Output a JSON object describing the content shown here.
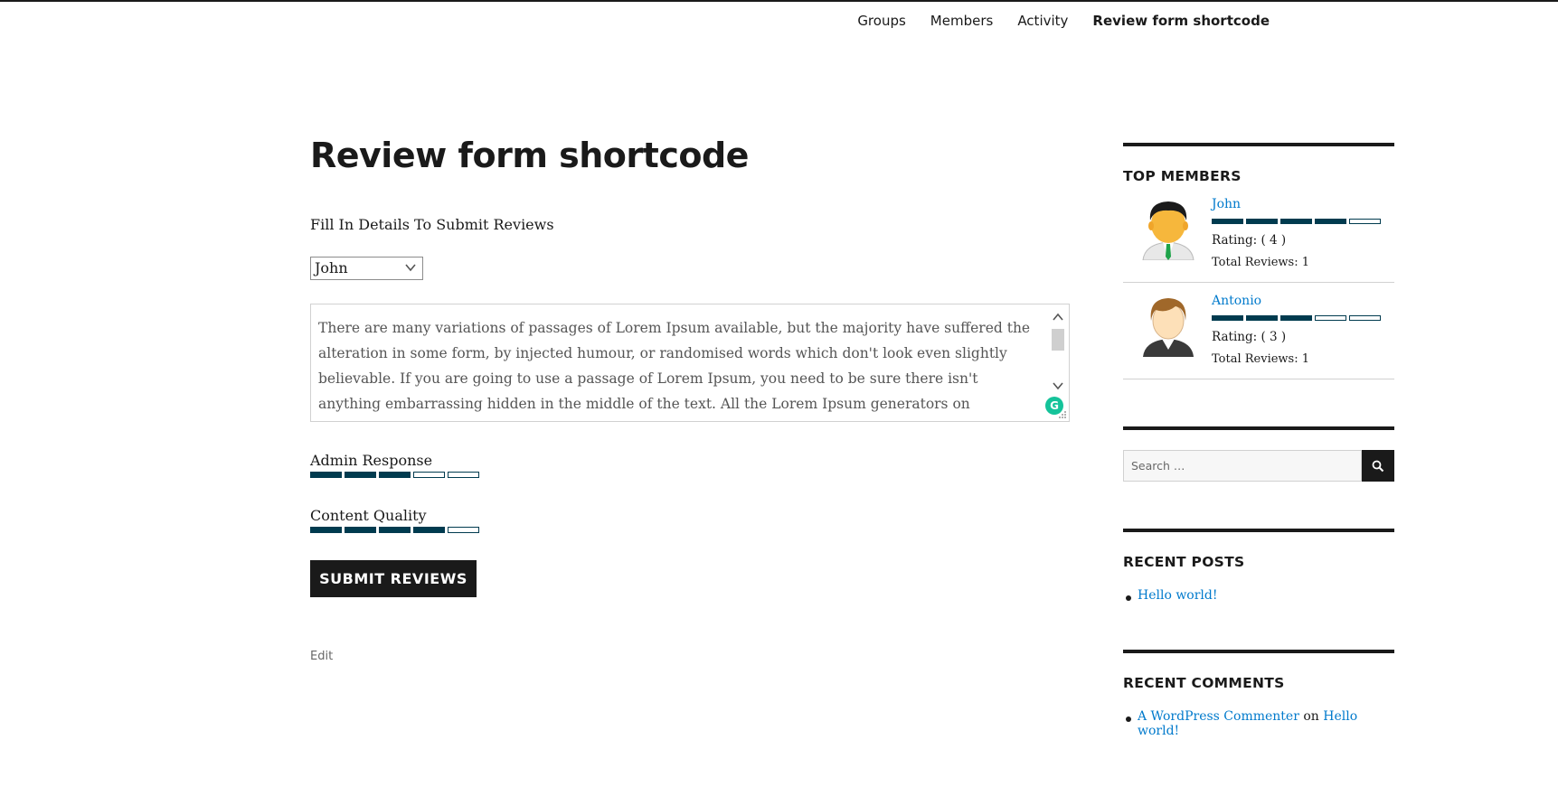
{
  "nav": {
    "items": [
      "Groups",
      "Members",
      "Activity",
      "Review form shortcode"
    ],
    "current": "Review form shortcode"
  },
  "main": {
    "title": "Review form shortcode",
    "intro": "Fill In Details To Submit Reviews",
    "member_select": {
      "selected": "John"
    },
    "review_text": "There are many variations of passages of Lorem Ipsum available, but the majority have suffered the alteration in some form, by injected humour, or randomised words which don't look even slightly believable. If you are going to use a passage of Lorem Ipsum, you need to be sure there isn't anything embarrassing hidden in the middle of the text. All the Lorem Ipsum generators on",
    "ratings": [
      {
        "label": "Admin Response",
        "value": 3,
        "max": 5
      },
      {
        "label": "Content Quality",
        "value": 4,
        "max": 5
      }
    ],
    "submit_label": "SUBMIT REVIEWS",
    "edit_label": "Edit"
  },
  "sidebar": {
    "top_members": {
      "title": "TOP MEMBERS",
      "members": [
        {
          "name": "John",
          "rating": 4,
          "rating_text": "Rating: ( 4 )",
          "total_text": "Total Reviews: 1",
          "avatar": "male-avatar-dark-hair-icon"
        },
        {
          "name": "Antonio",
          "rating": 3,
          "rating_text": "Rating: ( 3 )",
          "total_text": "Total Reviews: 1",
          "avatar": "male-avatar-brown-hair-icon"
        }
      ]
    },
    "search": {
      "placeholder": "Search …"
    },
    "recent_posts": {
      "title": "RECENT POSTS",
      "items": [
        "Hello world!"
      ]
    },
    "recent_comments": {
      "title": "RECENT COMMENTS",
      "items": [
        {
          "author": "A WordPress Commenter",
          "on": "on",
          "post": "Hello world!"
        }
      ]
    }
  },
  "colors": {
    "accent": "#003b4f",
    "link": "#007acc",
    "text": "#1a1a1a",
    "button_bg": "#1a1a1a",
    "grammarly": "#15c39a"
  }
}
